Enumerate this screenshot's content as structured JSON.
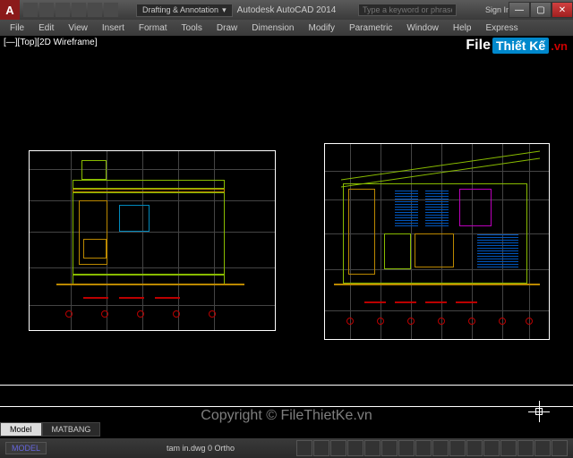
{
  "titlebar": {
    "app_letter": "A",
    "workspace": "Drafting & Annotation",
    "title": "Autodesk AutoCAD 2014",
    "search_placeholder": "Type a keyword or phrase",
    "signin": "Sign In"
  },
  "menu": {
    "items": [
      "File",
      "Edit",
      "View",
      "Insert",
      "Format",
      "Tools",
      "Draw",
      "Dimension",
      "Modify",
      "Parametric",
      "Window",
      "Help",
      "Express"
    ]
  },
  "viewport": {
    "label": "[—][Top][2D Wireframe]"
  },
  "watermark": {
    "file": "File",
    "thietke": "Thiết Kế",
    "vn": ".vn",
    "copyright": "Copyright © FileThietKe.vn"
  },
  "tabs": {
    "model": "Model",
    "layout": "MATBANG"
  },
  "status": {
    "model_label": "MODEL",
    "file_info": "tam in.dwg 0 Ortho"
  }
}
